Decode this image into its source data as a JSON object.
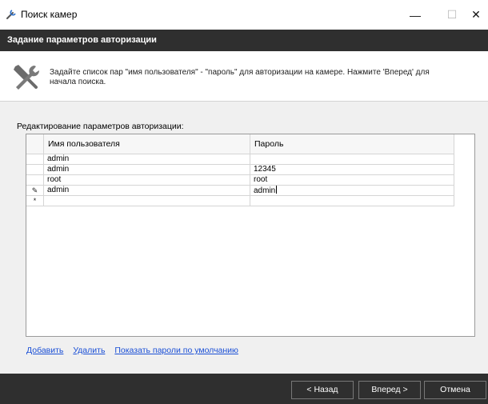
{
  "window": {
    "title": "Поиск камер",
    "minimize": "—",
    "maximize": "☐",
    "close": "✕"
  },
  "header": {
    "title": "Задание параметров авторизации"
  },
  "info": {
    "icon": "tools-icon",
    "description": "Задайте список пар \"имя пользователя\" - \"пароль\" для авторизации на камере. Нажмите 'Вперед' для начала поиска."
  },
  "editor": {
    "section_label": "Редактирование параметров авторизации:",
    "columns": {
      "user": "Имя пользователя",
      "password": "Пароль"
    },
    "rows": [
      {
        "marker": "",
        "user": "admin",
        "password": ""
      },
      {
        "marker": "",
        "user": "admin",
        "password": "12345"
      },
      {
        "marker": "",
        "user": "root",
        "password": "root"
      },
      {
        "marker": "✎",
        "user": "admin",
        "password": "admin"
      },
      {
        "marker": "*",
        "user": "",
        "password": ""
      }
    ]
  },
  "links": {
    "add": "Добавить",
    "remove": "Удалить",
    "show_defaults": "Показать пароли по умолчанию"
  },
  "footer": {
    "back": "< Назад",
    "next": "Вперед >",
    "cancel": "Отмена"
  },
  "colors": {
    "header_bg": "#2f2f2f",
    "link": "#1a4fd6",
    "content_bg": "#f0f0f0"
  }
}
